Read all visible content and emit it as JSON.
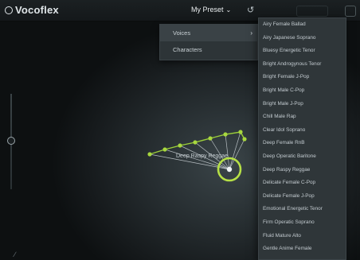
{
  "app": {
    "name": "Vocoflex"
  },
  "header": {
    "preset_label": "My Preset",
    "preset_chevron": "chevron-down-icon",
    "reset_icon": "undo-icon"
  },
  "graph": {
    "selected_voice": "Deep Raspy Reggae",
    "accent_color": "#9ccf3a"
  },
  "menu": {
    "items": [
      {
        "label": "Voices",
        "has_submenu": true
      },
      {
        "label": "Characters",
        "has_submenu": false
      }
    ]
  },
  "submenu": {
    "items": [
      "Airy Female Ballad",
      "Airy Japanese Soprano",
      "Bluesy Energetic Tenor",
      "Bright Androgynous Tenor",
      "Bright Female J-Pop",
      "Bright Male C-Pop",
      "Bright Male J-Pop",
      "Chill Male Rap",
      "Clear Idol Soprano",
      "Deep Female RnB",
      "Deep Operatic Baritone",
      "Deep Raspy Reggae",
      "Delicate Female C-Pop",
      "Delicate Female J-Pop",
      "Emotional Energetic Tenor",
      "Firm Operatic Soprano",
      "Fluid Mature Alto",
      "Gentle Anime Female"
    ]
  }
}
